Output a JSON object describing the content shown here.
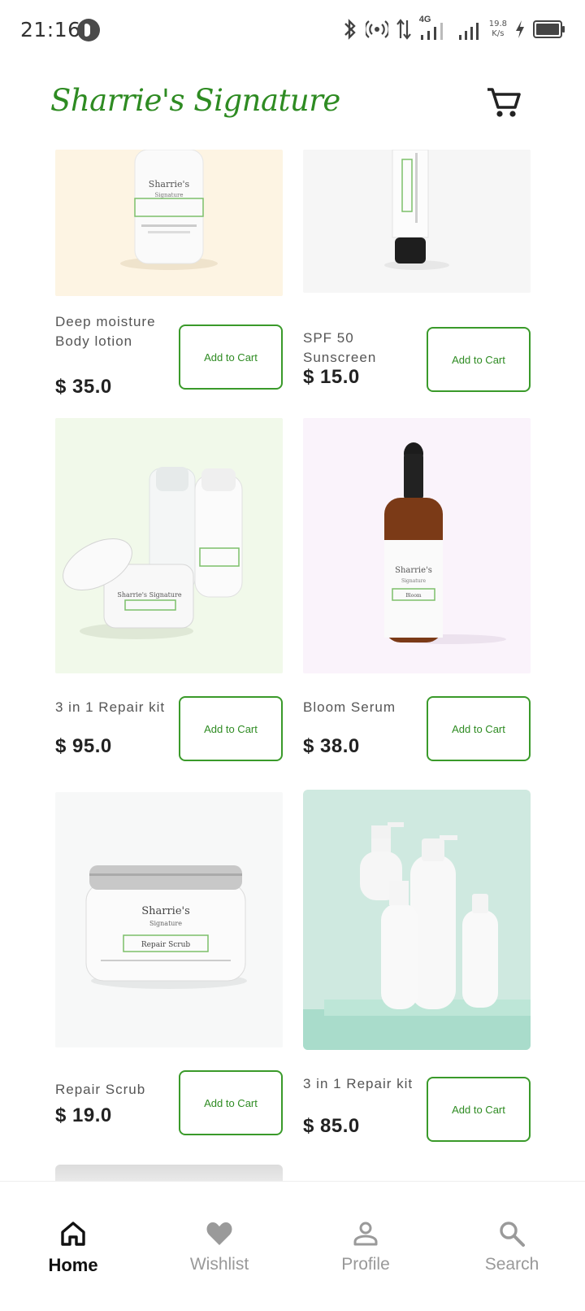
{
  "status_bar": {
    "time": "21:16",
    "network": "4G",
    "net_speed_value": "19.8",
    "net_speed_unit": "K/s",
    "icons": [
      "app-p-icon",
      "bluetooth-icon",
      "hotspot-icon",
      "data-arrows-icon",
      "signal-icon",
      "signal-icon",
      "charging-icon",
      "battery-icon"
    ]
  },
  "header": {
    "title": "Sharrie's Signature",
    "cart_icon": "shopping-cart-icon"
  },
  "products": [
    {
      "name": "Deep moisture Body lotion",
      "price": "$ 35.0",
      "button": "Add to Cart",
      "label": "Sharrie's",
      "sublabel": "Signature",
      "image_bg": "#fdf4e3"
    },
    {
      "name": "SPF 50 Sunscreen",
      "price": "$ 15.0",
      "button": "Add to Cart",
      "image_bg": "#f6f6f6"
    },
    {
      "name": "3 in 1 Repair kit",
      "price": "$ 95.0",
      "button": "Add to Cart",
      "label": "Sharrie's Signature",
      "image_bg": "#f1f9ea"
    },
    {
      "name": "Bloom Serum",
      "price": "$ 38.0",
      "button": "Add to Cart",
      "label": "Sharrie's",
      "sublabel": "Signature",
      "tag": "Bloom",
      "image_bg": "#faf3fb"
    },
    {
      "name": "Repair Scrub",
      "price": "$ 19.0",
      "button": "Add to Cart",
      "label": "Sharrie's",
      "sublabel": "Signature",
      "tag": "Repair Scrub",
      "image_bg": "#f7f8f8"
    },
    {
      "name": "3 in 1 Repair kit",
      "price": "$ 85.0",
      "button": "Add to Cart",
      "image_bg": "#cfe9e0"
    }
  ],
  "nav": {
    "items": [
      {
        "label": "Home",
        "icon": "home-icon",
        "active": true
      },
      {
        "label": "Wishlist",
        "icon": "heart-icon",
        "active": false
      },
      {
        "label": "Profile",
        "icon": "person-icon",
        "active": false
      },
      {
        "label": "Search",
        "icon": "search-icon",
        "active": false
      }
    ]
  },
  "colors": {
    "brand": "#2e8b22",
    "button_border": "#3a9a2a",
    "nav_active": "#111111",
    "nav_inactive": "#999999"
  }
}
